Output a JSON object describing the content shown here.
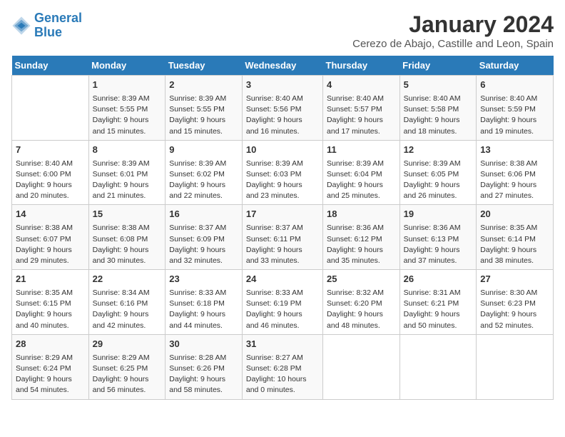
{
  "header": {
    "logo_line1": "General",
    "logo_line2": "Blue",
    "title": "January 2024",
    "subtitle": "Cerezo de Abajo, Castille and Leon, Spain"
  },
  "days_of_week": [
    "Sunday",
    "Monday",
    "Tuesday",
    "Wednesday",
    "Thursday",
    "Friday",
    "Saturday"
  ],
  "weeks": [
    [
      {
        "day": "",
        "info": ""
      },
      {
        "day": "1",
        "info": "Sunrise: 8:39 AM\nSunset: 5:55 PM\nDaylight: 9 hours\nand 15 minutes."
      },
      {
        "day": "2",
        "info": "Sunrise: 8:39 AM\nSunset: 5:55 PM\nDaylight: 9 hours\nand 15 minutes."
      },
      {
        "day": "3",
        "info": "Sunrise: 8:40 AM\nSunset: 5:56 PM\nDaylight: 9 hours\nand 16 minutes."
      },
      {
        "day": "4",
        "info": "Sunrise: 8:40 AM\nSunset: 5:57 PM\nDaylight: 9 hours\nand 17 minutes."
      },
      {
        "day": "5",
        "info": "Sunrise: 8:40 AM\nSunset: 5:58 PM\nDaylight: 9 hours\nand 18 minutes."
      },
      {
        "day": "6",
        "info": "Sunrise: 8:40 AM\nSunset: 5:59 PM\nDaylight: 9 hours\nand 19 minutes."
      }
    ],
    [
      {
        "day": "7",
        "info": "Sunrise: 8:40 AM\nSunset: 6:00 PM\nDaylight: 9 hours\nand 20 minutes."
      },
      {
        "day": "8",
        "info": "Sunrise: 8:39 AM\nSunset: 6:01 PM\nDaylight: 9 hours\nand 21 minutes."
      },
      {
        "day": "9",
        "info": "Sunrise: 8:39 AM\nSunset: 6:02 PM\nDaylight: 9 hours\nand 22 minutes."
      },
      {
        "day": "10",
        "info": "Sunrise: 8:39 AM\nSunset: 6:03 PM\nDaylight: 9 hours\nand 23 minutes."
      },
      {
        "day": "11",
        "info": "Sunrise: 8:39 AM\nSunset: 6:04 PM\nDaylight: 9 hours\nand 25 minutes."
      },
      {
        "day": "12",
        "info": "Sunrise: 8:39 AM\nSunset: 6:05 PM\nDaylight: 9 hours\nand 26 minutes."
      },
      {
        "day": "13",
        "info": "Sunrise: 8:38 AM\nSunset: 6:06 PM\nDaylight: 9 hours\nand 27 minutes."
      }
    ],
    [
      {
        "day": "14",
        "info": "Sunrise: 8:38 AM\nSunset: 6:07 PM\nDaylight: 9 hours\nand 29 minutes."
      },
      {
        "day": "15",
        "info": "Sunrise: 8:38 AM\nSunset: 6:08 PM\nDaylight: 9 hours\nand 30 minutes."
      },
      {
        "day": "16",
        "info": "Sunrise: 8:37 AM\nSunset: 6:09 PM\nDaylight: 9 hours\nand 32 minutes."
      },
      {
        "day": "17",
        "info": "Sunrise: 8:37 AM\nSunset: 6:11 PM\nDaylight: 9 hours\nand 33 minutes."
      },
      {
        "day": "18",
        "info": "Sunrise: 8:36 AM\nSunset: 6:12 PM\nDaylight: 9 hours\nand 35 minutes."
      },
      {
        "day": "19",
        "info": "Sunrise: 8:36 AM\nSunset: 6:13 PM\nDaylight: 9 hours\nand 37 minutes."
      },
      {
        "day": "20",
        "info": "Sunrise: 8:35 AM\nSunset: 6:14 PM\nDaylight: 9 hours\nand 38 minutes."
      }
    ],
    [
      {
        "day": "21",
        "info": "Sunrise: 8:35 AM\nSunset: 6:15 PM\nDaylight: 9 hours\nand 40 minutes."
      },
      {
        "day": "22",
        "info": "Sunrise: 8:34 AM\nSunset: 6:16 PM\nDaylight: 9 hours\nand 42 minutes."
      },
      {
        "day": "23",
        "info": "Sunrise: 8:33 AM\nSunset: 6:18 PM\nDaylight: 9 hours\nand 44 minutes."
      },
      {
        "day": "24",
        "info": "Sunrise: 8:33 AM\nSunset: 6:19 PM\nDaylight: 9 hours\nand 46 minutes."
      },
      {
        "day": "25",
        "info": "Sunrise: 8:32 AM\nSunset: 6:20 PM\nDaylight: 9 hours\nand 48 minutes."
      },
      {
        "day": "26",
        "info": "Sunrise: 8:31 AM\nSunset: 6:21 PM\nDaylight: 9 hours\nand 50 minutes."
      },
      {
        "day": "27",
        "info": "Sunrise: 8:30 AM\nSunset: 6:23 PM\nDaylight: 9 hours\nand 52 minutes."
      }
    ],
    [
      {
        "day": "28",
        "info": "Sunrise: 8:29 AM\nSunset: 6:24 PM\nDaylight: 9 hours\nand 54 minutes."
      },
      {
        "day": "29",
        "info": "Sunrise: 8:29 AM\nSunset: 6:25 PM\nDaylight: 9 hours\nand 56 minutes."
      },
      {
        "day": "30",
        "info": "Sunrise: 8:28 AM\nSunset: 6:26 PM\nDaylight: 9 hours\nand 58 minutes."
      },
      {
        "day": "31",
        "info": "Sunrise: 8:27 AM\nSunset: 6:28 PM\nDaylight: 10 hours\nand 0 minutes."
      },
      {
        "day": "",
        "info": ""
      },
      {
        "day": "",
        "info": ""
      },
      {
        "day": "",
        "info": ""
      }
    ]
  ]
}
